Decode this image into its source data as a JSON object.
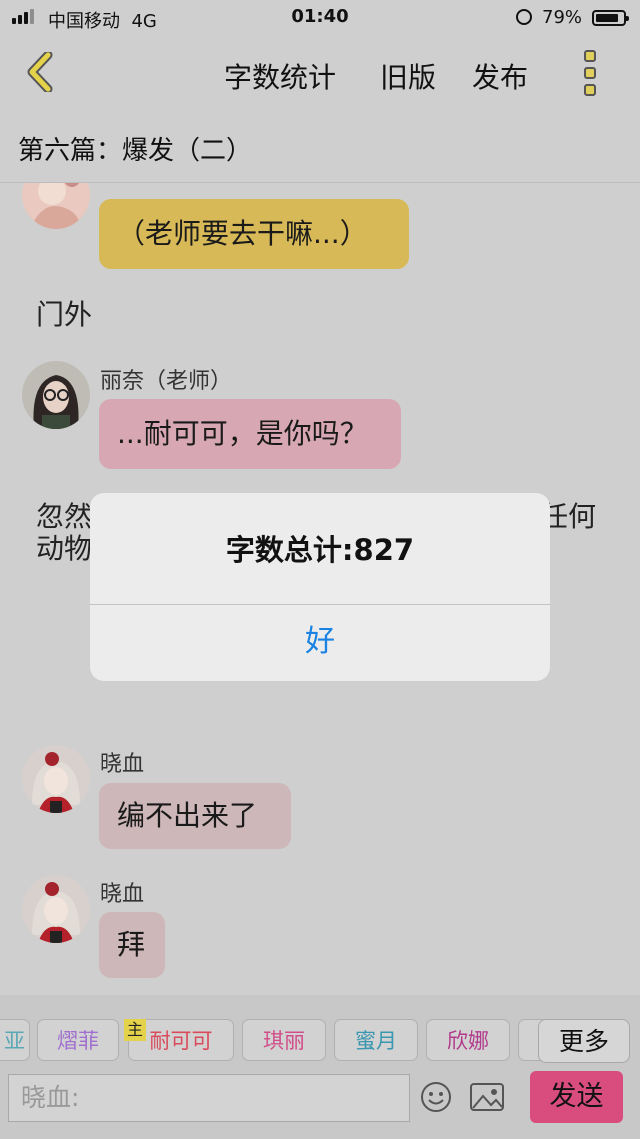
{
  "status": {
    "carrier": "中国移动",
    "network": "4G",
    "time": "01:40",
    "battery": "79%",
    "battery_level": 0.79
  },
  "nav": {
    "word_count": "字数统计",
    "old_version": "旧版",
    "publish": "发布"
  },
  "chapter": {
    "title": "第六篇：爆发（二）"
  },
  "messages": [
    {
      "name": "",
      "text": "（老师要去干嘛...）",
      "bubble_color": "#d8b957"
    },
    {
      "narration": "门外"
    },
    {
      "name": "丽奈（老师）",
      "text": "...耐可可，是你吗？",
      "bubble_color": "#d7a8b4"
    },
    {
      "narration_left": "忽然",
      "narration_left2": "动物",
      "narration_right": "任何"
    },
    {
      "name": "晓血",
      "text": "编不出来了",
      "bubble_color": "#cdb7b9"
    },
    {
      "name": "晓血",
      "text": "拜",
      "bubble_color": "#cdb7b9"
    }
  ],
  "characters": [
    {
      "label": "亚",
      "color": "#5aa8b4"
    },
    {
      "label": "熠菲",
      "color": "#a06fd0"
    },
    {
      "label": "耐可可",
      "color": "#d94a5a",
      "badge": "主"
    },
    {
      "label": "琪丽",
      "color": "#d24e8a"
    },
    {
      "label": "蜜月",
      "color": "#3a97b0"
    },
    {
      "label": "欣娜",
      "color": "#b23a8c"
    }
  ],
  "more_button": "更多",
  "input": {
    "placeholder": "晓血:"
  },
  "send_button": "发送",
  "alert": {
    "message": "字数总计:827",
    "ok": "好"
  }
}
